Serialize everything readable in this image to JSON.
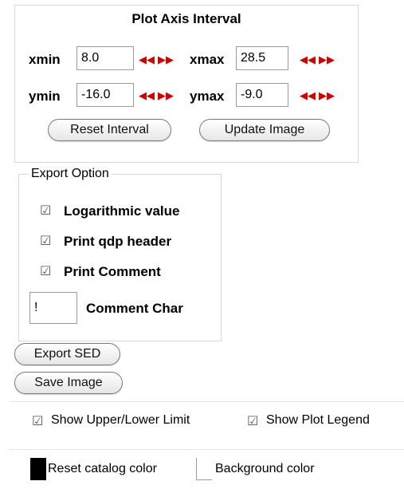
{
  "axis_interval": {
    "title": "Plot Axis Interval",
    "xmin_label": "xmin",
    "xmin_value": "8.0",
    "xmax_label": "xmax",
    "xmax_value": "28.5",
    "ymin_label": "ymin",
    "ymin_value": "-16.0",
    "ymax_label": "ymax",
    "ymax_value": "-9.0",
    "left_arrow_glyph": "◀◀",
    "right_arrow_glyph": "▶▶",
    "reset_label": "Reset Interval",
    "update_label": "Update Image"
  },
  "export": {
    "legend": "Export Option",
    "check_glyph": "☑",
    "options": [
      {
        "label": "Logarithmic value",
        "checked": true
      },
      {
        "label": "Print qdp header",
        "checked": true
      },
      {
        "label": "Print Comment",
        "checked": true
      }
    ],
    "comment_char_value": "!",
    "comment_char_label": "Comment Char"
  },
  "buttons": {
    "export_sed": "Export SED",
    "save_image": "Save Image"
  },
  "display": {
    "show_limit_label": "Show Upper/Lower Limit",
    "show_legend_label": "Show Plot Legend"
  },
  "colors": {
    "reset_catalog_label": "Reset catalog color",
    "background_label": "Background color",
    "catalog_color": "#000000",
    "background_color": "#ffffff",
    "arrow_color": "#d40000"
  }
}
